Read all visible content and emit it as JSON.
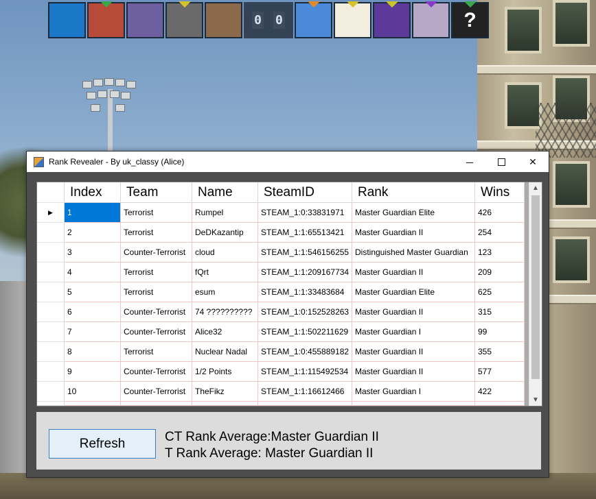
{
  "window": {
    "title": "Rank Revealer - By uk_classy (Alice)",
    "minimize_glyph": "",
    "close_glyph": "✕"
  },
  "hud": {
    "left_team": [
      {
        "icon": "blue-face-avatar",
        "bg": "#1b78c8"
      },
      {
        "icon": "paper-bag-avatar",
        "bg": "#b84a3a"
      },
      {
        "icon": "skeletor-avatar",
        "bg": "#6e5fa0"
      },
      {
        "icon": "man-smoking-avatar",
        "bg": "#6a6a6a"
      },
      {
        "icon": "woman-portrait-avatar",
        "bg": "#8a6a4a"
      }
    ],
    "score_left": "0",
    "score_right": "0",
    "right_team": [
      {
        "icon": "sky-landscape-avatar",
        "bg": "#4a8ad8"
      },
      {
        "icon": "cartoon-wpm-avatar",
        "bg": "#f1eee0"
      },
      {
        "icon": "purple-dragon-avatar",
        "bg": "#5b3a9a"
      },
      {
        "icon": "woman-white-avatar",
        "bg": "#b8a8c8"
      },
      {
        "icon": "question-mark-avatar",
        "bg": "#222222",
        "text": "?"
      }
    ],
    "mark_colors": [
      "#3aa84a",
      "#d6c22a",
      "#e08a2a",
      "#c9c42a",
      "#8a3ac8"
    ]
  },
  "grid": {
    "columns": [
      "Index",
      "Team",
      "Name",
      "SteamID",
      "Rank",
      "Wins"
    ],
    "rows": [
      [
        "1",
        "Terrorist",
        "Rumpel",
        "STEAM_1:0:33831971",
        "Master Guardian Elite",
        "426"
      ],
      [
        "2",
        "Terrorist",
        "DeDKazantip",
        "STEAM_1:1:65513421",
        "Master Guardian II",
        "254"
      ],
      [
        "3",
        "Counter-Terrorist",
        "cloud",
        "STEAM_1:1:546156255",
        "Distinguished Master Guardian",
        "123"
      ],
      [
        "4",
        "Terrorist",
        "fQrt",
        "STEAM_1:1:209167734",
        "Master Guardian II",
        "209"
      ],
      [
        "5",
        "Terrorist",
        "esum",
        "STEAM_1:1:33483684",
        "Master Guardian Elite",
        "625"
      ],
      [
        "6",
        "Counter-Terrorist",
        "74 ??????????",
        "STEAM_1:0:152528263",
        "Master Guardian II",
        "315"
      ],
      [
        "7",
        "Counter-Terrorist",
        "Alice32",
        "STEAM_1:1:502211629",
        "Master Guardian I",
        "99"
      ],
      [
        "8",
        "Terrorist",
        "Nuclear Nadal",
        "STEAM_1:0:455889182",
        "Master Guardian II",
        "355"
      ],
      [
        "9",
        "Counter-Terrorist",
        "1/2 Points",
        "STEAM_1:1:115492534",
        "Master Guardian II",
        "577"
      ],
      [
        "10",
        "Counter-Terrorist",
        "TheFikz",
        "STEAM_1:1:16612466",
        "Master Guardian I",
        "422"
      ]
    ],
    "current_row_marker": "▶",
    "selected_color": "#0078d7"
  },
  "panel": {
    "refresh_label": "Refresh",
    "ct_average": "CT Rank Average:Master Guardian II",
    "t_average": "T Rank Average: Master Guardian II"
  }
}
